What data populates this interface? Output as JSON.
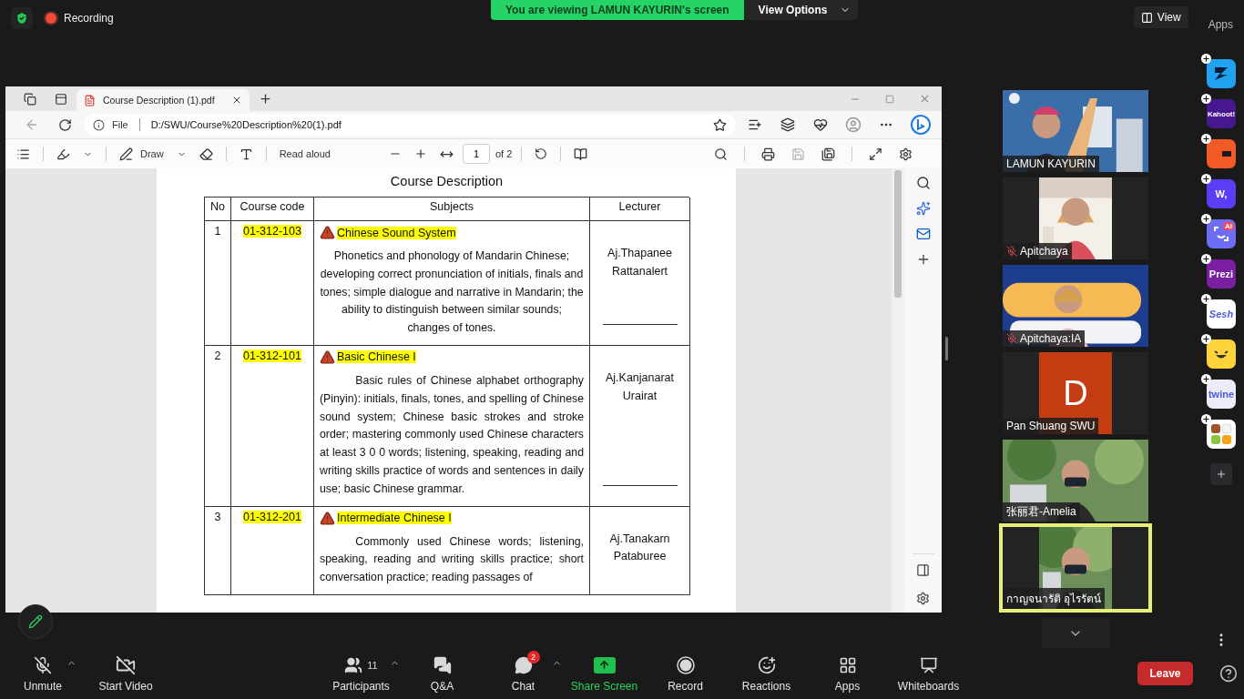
{
  "top_bar": {
    "recording": "Recording",
    "viewing_banner": "You are viewing LAMUN KAYURIN's screen",
    "view_options": "View Options",
    "view_button": "View",
    "apps_label": "Apps"
  },
  "browser": {
    "tab": {
      "title": "Course Description (1).pdf",
      "selected": true
    },
    "address": {
      "scheme": "File",
      "url": "D:/SWU/Course%20Description%20(1).pdf"
    },
    "pdf_toolbar": {
      "draw": "Draw",
      "read_aloud": "Read aloud",
      "page": "1",
      "page_count": "of 2",
      "save_disabled": true
    }
  },
  "document": {
    "title": "Course Description",
    "columns": [
      "No",
      "Course code",
      "Subjects",
      "Lecturer"
    ],
    "rows": [
      {
        "no": "1",
        "code": "01-312-103",
        "subject": "Chinese Sound System",
        "kind": "centered",
        "description": "Phonetics and phonology of Mandarin Chinese; developing correct pronunciation of initials, finals and tones; simple dialogue and narrative in Mandarin; the ability to distinguish between similar sounds; changes of tones.",
        "lecturer": "Aj.Thapanee Rattanalert",
        "signature_line": true
      },
      {
        "no": "2",
        "code": "01-312-101",
        "subject": "Basic Chinese I",
        "kind": "justified",
        "description": "Basic rules of Chinese alphabet orthography (Pinyin): initials, finals, tones, and spelling of Chinese sound system; Chinese basic strokes and stroke order; mastering commonly used Chinese characters at least 3 0 0  words; listening, speaking, reading and writing skills practice of words and sentences in daily use; basic Chinese grammar.",
        "lecturer": "Aj.Kanjanarat Urairat",
        "signature_line": true
      },
      {
        "no": "3",
        "code": "01-312-201",
        "subject": "Intermediate Chinese I",
        "kind": "justified",
        "description": "Commonly used Chinese words; listening, speaking, reading and writing skills practice; short conversation practice; reading passages of",
        "lecturer": "Aj.Tanakarn Pataburee",
        "signature_line": false
      }
    ]
  },
  "participants": [
    {
      "name": "LAMUN KAYURIN",
      "kind": "wide_video",
      "muted": false,
      "active_speaker": false
    },
    {
      "name": "Apitchaya",
      "kind": "narrow_video",
      "muted": true,
      "active_speaker": false
    },
    {
      "name": "Apitchaya:IA",
      "kind": "wide_video",
      "muted": true,
      "active_speaker": false
    },
    {
      "name": "Pan Shuang SWU",
      "kind": "avatar",
      "letter": "D",
      "color": "#c43c12",
      "muted": false,
      "active_speaker": false
    },
    {
      "name": "张丽君-Amelia",
      "kind": "wide_video",
      "muted": false,
      "active_speaker": false
    },
    {
      "name": "กาญจนารัติ อุไรรัตน์",
      "kind": "narrow_video",
      "muted": false,
      "active_speaker": true
    }
  ],
  "apps": [
    {
      "kind": "arrow",
      "color": "#1fa2f0"
    },
    {
      "kind": "text",
      "label": "Kahoot!",
      "color": "#46178f"
    },
    {
      "kind": "block",
      "color": "#f25a26"
    },
    {
      "kind": "text",
      "label": "W,",
      "color": "#5b3df5"
    },
    {
      "kind": "ai",
      "label": "AI",
      "color": "#6d6cf5"
    },
    {
      "kind": "text",
      "label": "Prezi",
      "color": "#7a1fa2"
    },
    {
      "kind": "text",
      "label": "Sesh",
      "color": "#ffffff"
    },
    {
      "kind": "smiley",
      "color": "#ffd43b"
    },
    {
      "kind": "text",
      "label": "twine",
      "color": "#ececf8"
    },
    {
      "kind": "tiles",
      "color": "#ffffff"
    }
  ],
  "toolbar": {
    "items": [
      {
        "kind": "mic",
        "label": "Unmute",
        "off": true,
        "menu": true
      },
      {
        "kind": "video",
        "label": "Start Video",
        "off": true,
        "menu": false
      },
      {
        "kind": "participants",
        "label": "Participants",
        "count": "11",
        "menu": true
      },
      {
        "kind": "qa",
        "label": "Q&A",
        "menu": false
      },
      {
        "kind": "chat",
        "label": "Chat",
        "badge": "2",
        "menu": true
      },
      {
        "kind": "share",
        "label": "Share Screen",
        "menu": false
      },
      {
        "kind": "record",
        "label": "Record",
        "menu": false
      },
      {
        "kind": "reactions",
        "label": "Reactions",
        "menu": false
      },
      {
        "kind": "apps",
        "label": "Apps",
        "menu": false
      },
      {
        "kind": "whiteboards",
        "label": "Whiteboards",
        "menu": false
      }
    ],
    "leave": "Leave"
  }
}
